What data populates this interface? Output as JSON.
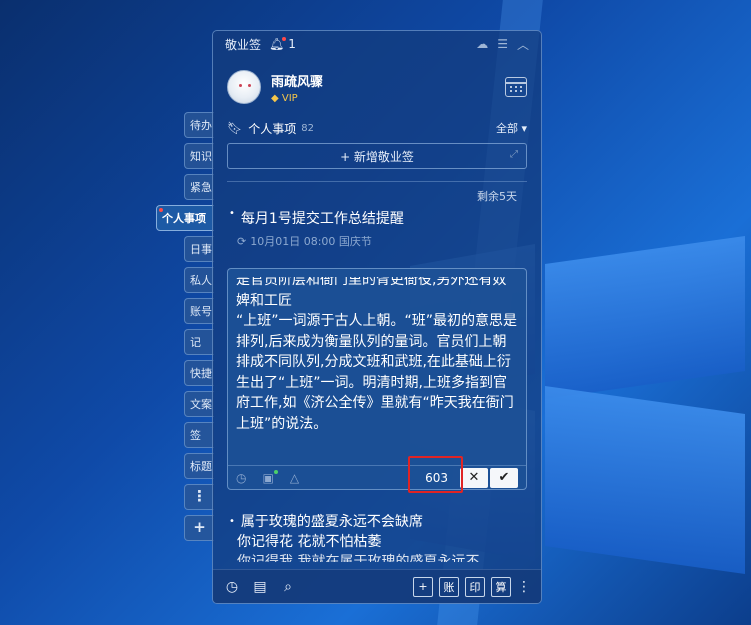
{
  "window": {
    "title": "敬业签",
    "notification_count": "1"
  },
  "user": {
    "name": "雨疏风骤",
    "badge": "VIP"
  },
  "sidebar": {
    "tabs": [
      {
        "label": "待办",
        "active": false
      },
      {
        "label": "知识",
        "active": false
      },
      {
        "label": "紧急",
        "active": false
      },
      {
        "label": "个人事项",
        "active": true
      },
      {
        "label": "日事",
        "active": false
      },
      {
        "label": "私人",
        "active": false
      },
      {
        "label": "账号",
        "active": false
      },
      {
        "label": "记",
        "active": false
      },
      {
        "label": "快捷",
        "active": false
      },
      {
        "label": "文案",
        "active": false
      },
      {
        "label": "签",
        "active": false
      },
      {
        "label": "标题",
        "active": false
      }
    ],
    "more_label": "⋮",
    "add_label": "+"
  },
  "section": {
    "title": "个人事项",
    "count": "82",
    "filter": "全部"
  },
  "add_button": {
    "label": "+ 新增敬业签"
  },
  "remaining": "剩余5天",
  "note1": {
    "title": "每月1号提交工作总结提醒",
    "reminder": "10月01日 08:00 国庆节"
  },
  "editor": {
    "paragraphs": [
      "是官员阶层和衙门里的胥吏衙役,另外还有奴婢和工匠",
      "“上班”一词源于古人上朝。“班”最初的意思是排列,后来成为衡量队列的量词。官员们上朝排成不同队列,分成文班和武班,在此基础上衍生出了“上班”一词。明清时期,上班多指到官府工作,如《济公全传》里就有“昨天我在衙门上班”的说法。"
    ],
    "char_count": "603",
    "cancel_label": "✕",
    "confirm_label": "✔"
  },
  "note2": {
    "title": "属于玫瑰的盛夏永远不会缺席",
    "line2": "你记得花 花就不怕枯萎",
    "line3": "你记得我 我就在属于玫瑰的盛夏永远不"
  },
  "bottombar": {
    "btn_add": "+",
    "btn_account": "账",
    "btn_print": "印",
    "btn_calc": "算"
  },
  "colors": {
    "accent": "#1d5aa5",
    "highlight": "#e02424",
    "vip": "#f5c64a"
  }
}
